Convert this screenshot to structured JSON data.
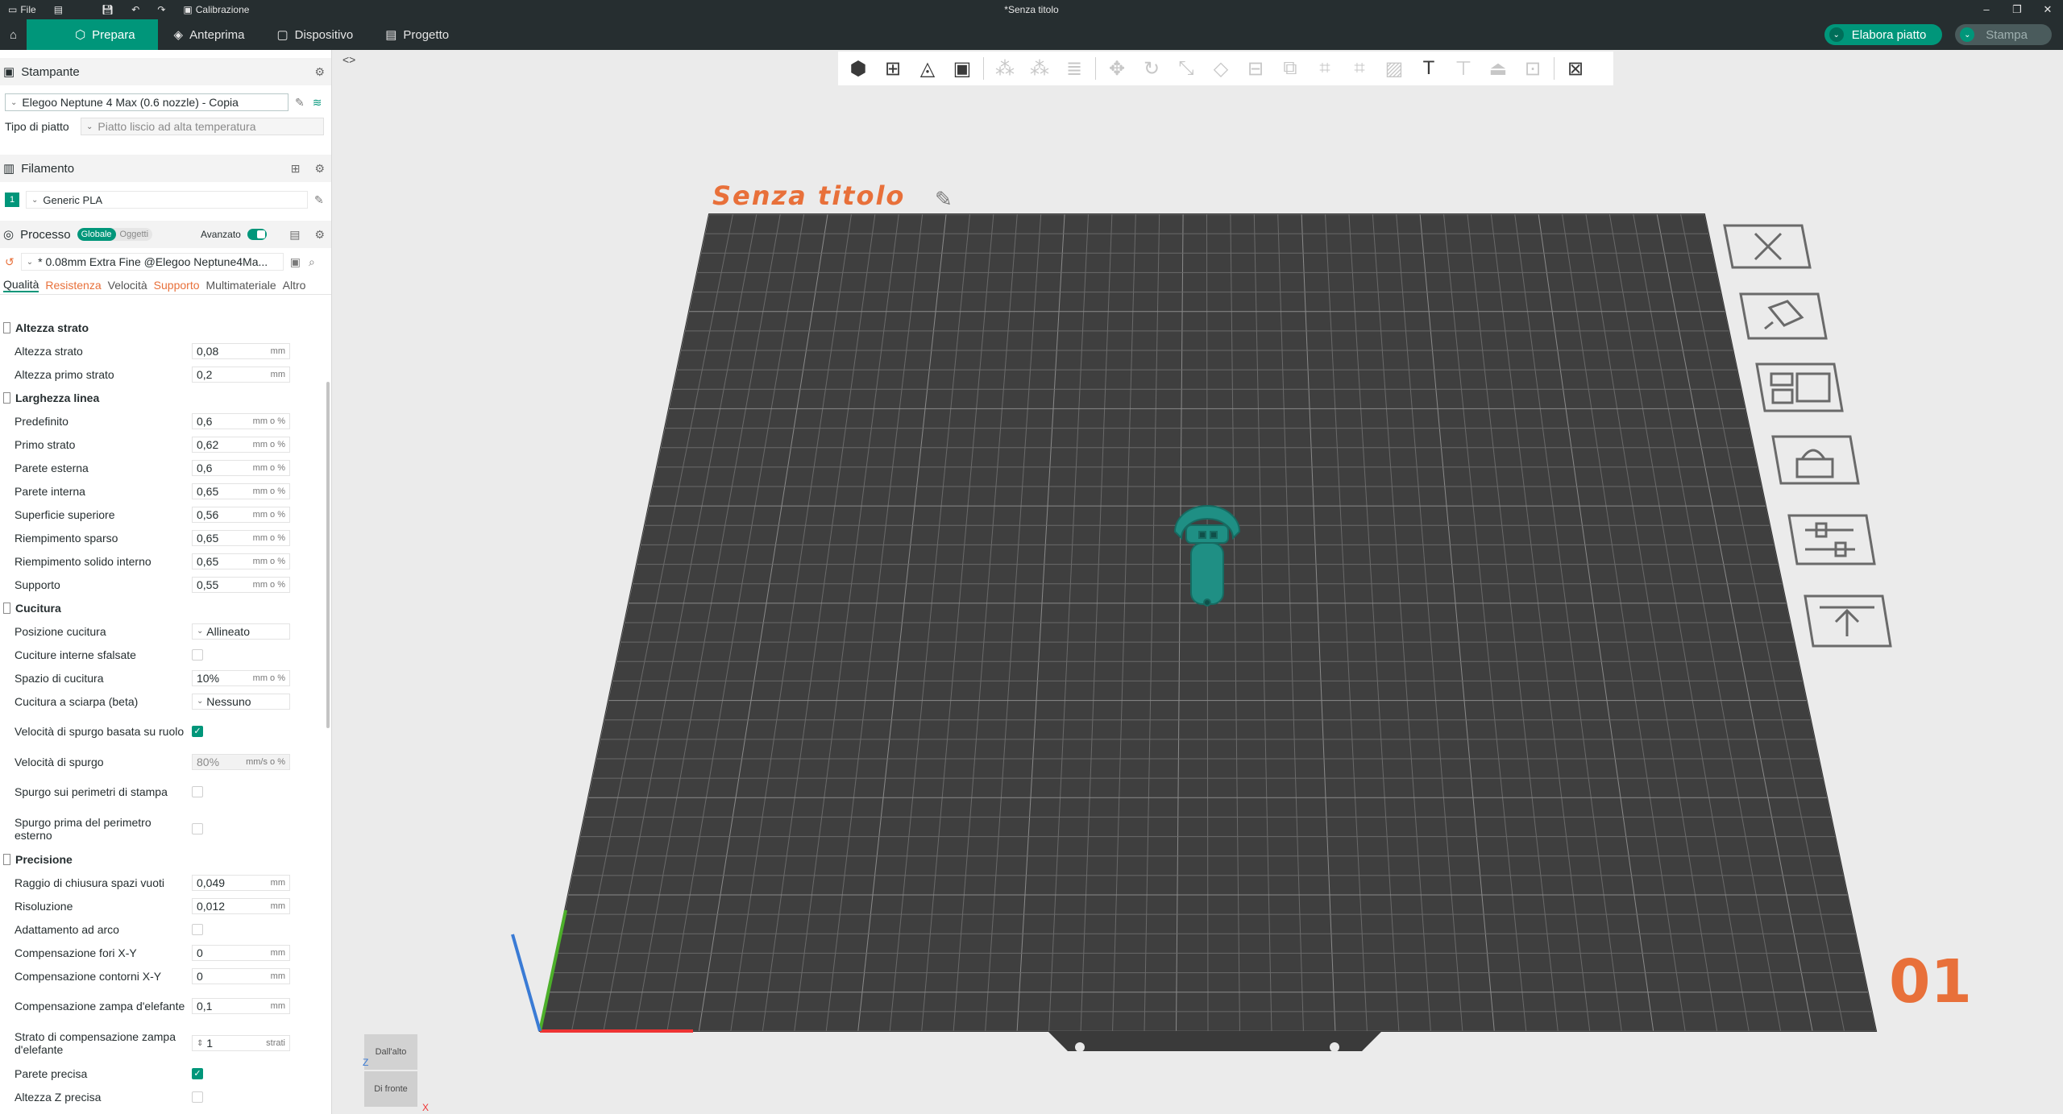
{
  "titlebar": {
    "file_label": "File",
    "calibration_label": "Calibrazione",
    "window_title": "*Senza titolo"
  },
  "tabs": [
    {
      "label": "Prepara"
    },
    {
      "label": "Anteprima"
    },
    {
      "label": "Dispositivo"
    },
    {
      "label": "Progetto"
    }
  ],
  "actions": {
    "slice_label": "Elabora piatto",
    "print_label": "Stampa"
  },
  "printer": {
    "section_label": "Stampante",
    "selected": "Elegoo Neptune 4 Max (0.6 nozzle) - Copia",
    "plate_type_label": "Tipo di piatto",
    "plate_type_value": "Piatto liscio ad alta temperatura"
  },
  "filament": {
    "section_label": "Filamento",
    "slot": "1",
    "selected": "Generic PLA"
  },
  "process": {
    "section_label": "Processo",
    "global_label": "Globale",
    "objects_label": "Oggetti",
    "advanced_label": "Avanzato",
    "preset": "* 0.08mm Extra Fine @Elegoo Neptune4Ma...",
    "param_tabs": [
      "Qualità",
      "Resistenza",
      "Velocità",
      "Supporto",
      "Multimateriale",
      "Altro"
    ]
  },
  "groups": {
    "layer_height": {
      "title": "Altezza strato",
      "items": [
        {
          "label": "Altezza strato",
          "value": "0,08",
          "unit": "mm"
        },
        {
          "label": "Altezza primo strato",
          "value": "0,2",
          "unit": "mm"
        }
      ]
    },
    "line_width": {
      "title": "Larghezza linea",
      "items": [
        {
          "label": "Predefinito",
          "value": "0,6",
          "unit": "mm o %"
        },
        {
          "label": "Primo strato",
          "value": "0,62",
          "unit": "mm o %"
        },
        {
          "label": "Parete esterna",
          "value": "0,6",
          "unit": "mm o %"
        },
        {
          "label": "Parete interna",
          "value": "0,65",
          "unit": "mm o %"
        },
        {
          "label": "Superficie superiore",
          "value": "0,56",
          "unit": "mm o %"
        },
        {
          "label": "Riempimento sparso",
          "value": "0,65",
          "unit": "mm o %"
        },
        {
          "label": "Riempimento solido interno",
          "value": "0,65",
          "unit": "mm o %"
        },
        {
          "label": "Supporto",
          "value": "0,55",
          "unit": "mm o %"
        }
      ]
    },
    "seam": {
      "title": "Cucitura",
      "position_label": "Posizione cucitura",
      "position_value": "Allineato",
      "staggered_label": "Cuciture interne sfalsate",
      "gap_label": "Spazio di cucitura",
      "gap_value": "10%",
      "gap_unit": "mm o %",
      "scarf_label": "Cucitura a sciarpa (beta)",
      "scarf_value": "Nessuno",
      "wipe_speed_role_label": "Velocità di spurgo basata su ruolo",
      "wipe_speed_label": "Velocità di spurgo",
      "wipe_speed_value": "80%",
      "wipe_speed_unit": "mm/s o %",
      "wipe_loops_label": "Spurgo sui perimetri di stampa",
      "wipe_before_label": "Spurgo prima del perimetro esterno"
    },
    "precision": {
      "title": "Precisione",
      "closing_label": "Raggio di chiusura spazi vuoti",
      "closing_value": "0,049",
      "resolution_label": "Risoluzione",
      "resolution_value": "0,012",
      "arc_label": "Adattamento ad arco",
      "xy_hole_label": "Compensazione fori X-Y",
      "xy_hole_value": "0",
      "xy_contour_label": "Compensazione contorni X-Y",
      "xy_contour_value": "0",
      "elephant_label": "Compensazione zampa d'elefante",
      "elephant_value": "0,1",
      "elephant_layers_label": "Strato di compensazione zampa d'elefante",
      "elephant_layers_value": "1",
      "elephant_layers_unit": "strati",
      "precise_wall_label": "Parete precisa",
      "precise_z_label": "Altezza Z precisa",
      "unit_mm": "mm"
    }
  },
  "plate": {
    "name": "Senza titolo",
    "number": "01"
  },
  "view_cube": {
    "top_label": "Dall'alto",
    "front_label": "Di fronte",
    "x_label": "X",
    "z_label": "Z"
  },
  "colors": {
    "accent": "#00967a",
    "warning": "#e8703a",
    "bed": "#3f3f3f",
    "model": "#1f8f84"
  }
}
